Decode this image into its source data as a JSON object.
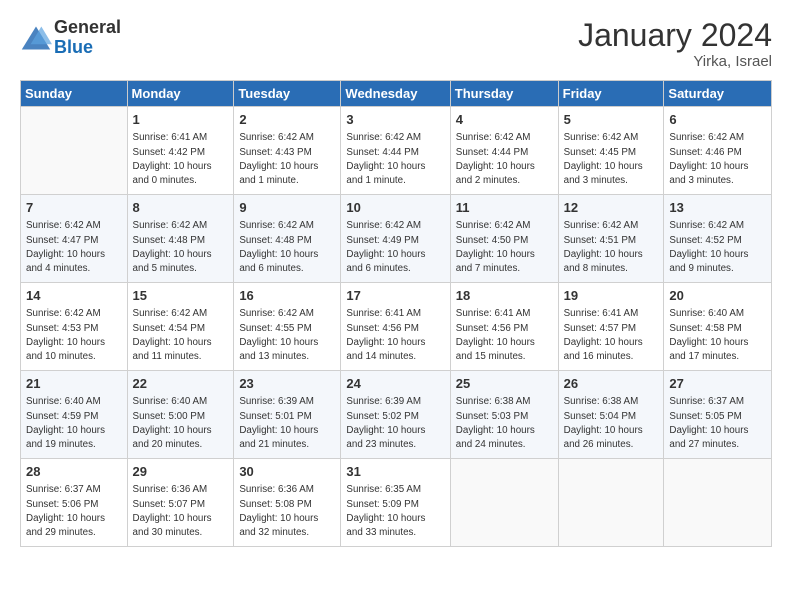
{
  "header": {
    "logo_general": "General",
    "logo_blue": "Blue",
    "month_title": "January 2024",
    "location": "Yirka, Israel"
  },
  "columns": [
    "Sunday",
    "Monday",
    "Tuesday",
    "Wednesday",
    "Thursday",
    "Friday",
    "Saturday"
  ],
  "weeks": [
    {
      "days": [
        {
          "num": "",
          "lines": []
        },
        {
          "num": "1",
          "lines": [
            "Sunrise: 6:41 AM",
            "Sunset: 4:42 PM",
            "Daylight: 10 hours",
            "and 0 minutes."
          ]
        },
        {
          "num": "2",
          "lines": [
            "Sunrise: 6:42 AM",
            "Sunset: 4:43 PM",
            "Daylight: 10 hours",
            "and 1 minute."
          ]
        },
        {
          "num": "3",
          "lines": [
            "Sunrise: 6:42 AM",
            "Sunset: 4:44 PM",
            "Daylight: 10 hours",
            "and 1 minute."
          ]
        },
        {
          "num": "4",
          "lines": [
            "Sunrise: 6:42 AM",
            "Sunset: 4:44 PM",
            "Daylight: 10 hours",
            "and 2 minutes."
          ]
        },
        {
          "num": "5",
          "lines": [
            "Sunrise: 6:42 AM",
            "Sunset: 4:45 PM",
            "Daylight: 10 hours",
            "and 3 minutes."
          ]
        },
        {
          "num": "6",
          "lines": [
            "Sunrise: 6:42 AM",
            "Sunset: 4:46 PM",
            "Daylight: 10 hours",
            "and 3 minutes."
          ]
        }
      ]
    },
    {
      "days": [
        {
          "num": "7",
          "lines": [
            "Sunrise: 6:42 AM",
            "Sunset: 4:47 PM",
            "Daylight: 10 hours",
            "and 4 minutes."
          ]
        },
        {
          "num": "8",
          "lines": [
            "Sunrise: 6:42 AM",
            "Sunset: 4:48 PM",
            "Daylight: 10 hours",
            "and 5 minutes."
          ]
        },
        {
          "num": "9",
          "lines": [
            "Sunrise: 6:42 AM",
            "Sunset: 4:48 PM",
            "Daylight: 10 hours",
            "and 6 minutes."
          ]
        },
        {
          "num": "10",
          "lines": [
            "Sunrise: 6:42 AM",
            "Sunset: 4:49 PM",
            "Daylight: 10 hours",
            "and 6 minutes."
          ]
        },
        {
          "num": "11",
          "lines": [
            "Sunrise: 6:42 AM",
            "Sunset: 4:50 PM",
            "Daylight: 10 hours",
            "and 7 minutes."
          ]
        },
        {
          "num": "12",
          "lines": [
            "Sunrise: 6:42 AM",
            "Sunset: 4:51 PM",
            "Daylight: 10 hours",
            "and 8 minutes."
          ]
        },
        {
          "num": "13",
          "lines": [
            "Sunrise: 6:42 AM",
            "Sunset: 4:52 PM",
            "Daylight: 10 hours",
            "and 9 minutes."
          ]
        }
      ]
    },
    {
      "days": [
        {
          "num": "14",
          "lines": [
            "Sunrise: 6:42 AM",
            "Sunset: 4:53 PM",
            "Daylight: 10 hours",
            "and 10 minutes."
          ]
        },
        {
          "num": "15",
          "lines": [
            "Sunrise: 6:42 AM",
            "Sunset: 4:54 PM",
            "Daylight: 10 hours",
            "and 11 minutes."
          ]
        },
        {
          "num": "16",
          "lines": [
            "Sunrise: 6:42 AM",
            "Sunset: 4:55 PM",
            "Daylight: 10 hours",
            "and 13 minutes."
          ]
        },
        {
          "num": "17",
          "lines": [
            "Sunrise: 6:41 AM",
            "Sunset: 4:56 PM",
            "Daylight: 10 hours",
            "and 14 minutes."
          ]
        },
        {
          "num": "18",
          "lines": [
            "Sunrise: 6:41 AM",
            "Sunset: 4:56 PM",
            "Daylight: 10 hours",
            "and 15 minutes."
          ]
        },
        {
          "num": "19",
          "lines": [
            "Sunrise: 6:41 AM",
            "Sunset: 4:57 PM",
            "Daylight: 10 hours",
            "and 16 minutes."
          ]
        },
        {
          "num": "20",
          "lines": [
            "Sunrise: 6:40 AM",
            "Sunset: 4:58 PM",
            "Daylight: 10 hours",
            "and 17 minutes."
          ]
        }
      ]
    },
    {
      "days": [
        {
          "num": "21",
          "lines": [
            "Sunrise: 6:40 AM",
            "Sunset: 4:59 PM",
            "Daylight: 10 hours",
            "and 19 minutes."
          ]
        },
        {
          "num": "22",
          "lines": [
            "Sunrise: 6:40 AM",
            "Sunset: 5:00 PM",
            "Daylight: 10 hours",
            "and 20 minutes."
          ]
        },
        {
          "num": "23",
          "lines": [
            "Sunrise: 6:39 AM",
            "Sunset: 5:01 PM",
            "Daylight: 10 hours",
            "and 21 minutes."
          ]
        },
        {
          "num": "24",
          "lines": [
            "Sunrise: 6:39 AM",
            "Sunset: 5:02 PM",
            "Daylight: 10 hours",
            "and 23 minutes."
          ]
        },
        {
          "num": "25",
          "lines": [
            "Sunrise: 6:38 AM",
            "Sunset: 5:03 PM",
            "Daylight: 10 hours",
            "and 24 minutes."
          ]
        },
        {
          "num": "26",
          "lines": [
            "Sunrise: 6:38 AM",
            "Sunset: 5:04 PM",
            "Daylight: 10 hours",
            "and 26 minutes."
          ]
        },
        {
          "num": "27",
          "lines": [
            "Sunrise: 6:37 AM",
            "Sunset: 5:05 PM",
            "Daylight: 10 hours",
            "and 27 minutes."
          ]
        }
      ]
    },
    {
      "days": [
        {
          "num": "28",
          "lines": [
            "Sunrise: 6:37 AM",
            "Sunset: 5:06 PM",
            "Daylight: 10 hours",
            "and 29 minutes."
          ]
        },
        {
          "num": "29",
          "lines": [
            "Sunrise: 6:36 AM",
            "Sunset: 5:07 PM",
            "Daylight: 10 hours",
            "and 30 minutes."
          ]
        },
        {
          "num": "30",
          "lines": [
            "Sunrise: 6:36 AM",
            "Sunset: 5:08 PM",
            "Daylight: 10 hours",
            "and 32 minutes."
          ]
        },
        {
          "num": "31",
          "lines": [
            "Sunrise: 6:35 AM",
            "Sunset: 5:09 PM",
            "Daylight: 10 hours",
            "and 33 minutes."
          ]
        },
        {
          "num": "",
          "lines": []
        },
        {
          "num": "",
          "lines": []
        },
        {
          "num": "",
          "lines": []
        }
      ]
    }
  ]
}
